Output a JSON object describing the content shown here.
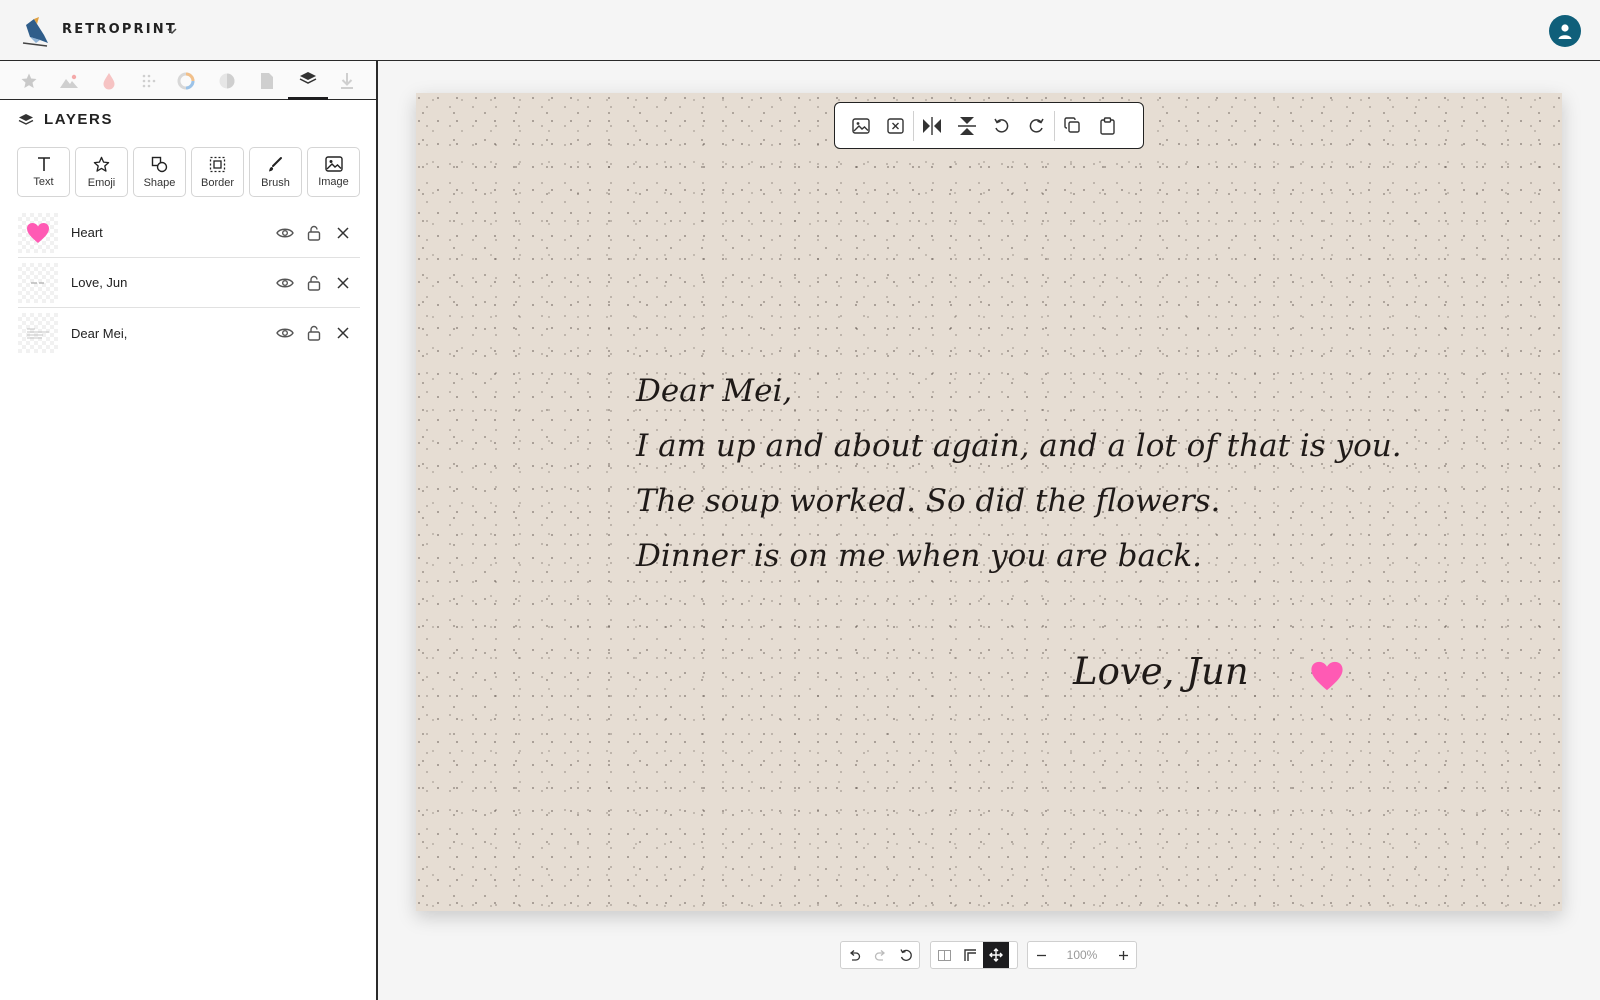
{
  "app": {
    "brand": "RETROPRINT"
  },
  "sidebar": {
    "tabs": [
      "star-icon",
      "mountain-icon",
      "drop-icon",
      "dots-icon",
      "palette-icon",
      "contrast-icon",
      "page-icon",
      "layers-icon",
      "download-icon"
    ],
    "active_tab": "layers-icon",
    "panel_title": "LAYERS",
    "tools": [
      {
        "label": "Text",
        "icon": "text-icon"
      },
      {
        "label": "Emoji",
        "icon": "star-outline-icon"
      },
      {
        "label": "Shape",
        "icon": "shape-icon"
      },
      {
        "label": "Border",
        "icon": "border-icon"
      },
      {
        "label": "Brush",
        "icon": "brush-icon"
      },
      {
        "label": "Image",
        "icon": "image-icon"
      }
    ],
    "layers": [
      {
        "name": "Heart"
      },
      {
        "name": "Love, Jun"
      },
      {
        "name": "Dear Mei,"
      }
    ]
  },
  "card": {
    "background": "#e6ddd3",
    "letter_lines": [
      "Dear Mei,",
      "I am up and about again, and a lot of that is you.",
      "The soup worked. So did the flowers.",
      "Dinner is on me when you are back."
    ],
    "signoff": "Love, Jun",
    "heart_color": "#ff5ab4"
  },
  "card_toolbar": [
    "image-icon",
    "remove-image-icon",
    "flip-horizontal-icon",
    "flip-vertical-icon",
    "rotate-left-icon",
    "rotate-right-icon",
    "duplicate-icon",
    "paste-icon"
  ],
  "bottom_toolbar": {
    "zoom": "100%"
  },
  "colors": {
    "accent": "#1d1d1f",
    "avatar": "#0f5f7a",
    "heart": "#ff5ab4"
  }
}
